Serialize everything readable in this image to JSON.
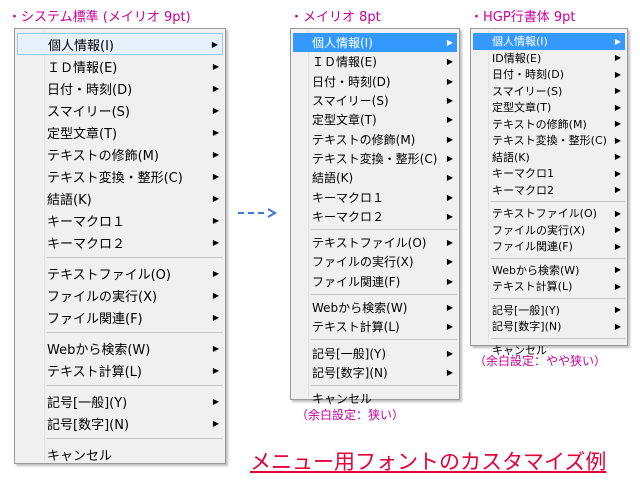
{
  "captions": {
    "menu1": "・システム標準 (メイリオ 9pt)",
    "menu2": "・メイリオ 8pt",
    "menu3": "・HGP行書体 9pt"
  },
  "notes": {
    "menu2": "（余白設定：狭い）",
    "menu3": "（余白設定：やや狭い）"
  },
  "footer": "メニュー用フォントのカスタマイズ例",
  "colors": {
    "caption": "#c8009a",
    "footer": "#e4003a",
    "highlight": "#3399ff",
    "arrow": "#4477dd"
  },
  "menu_groups": [
    [
      {
        "label": "個人情報(I)",
        "submenu": true
      },
      {
        "label": "ＩＤ情報(E)",
        "submenu": true
      },
      {
        "label": "日付・時刻(D)",
        "submenu": true
      },
      {
        "label": "スマイリー(S)",
        "submenu": true
      },
      {
        "label": "定型文章(T)",
        "submenu": true
      },
      {
        "label": "テキストの修飾(M)",
        "submenu": true
      },
      {
        "label": "テキスト変換・整形(C)",
        "submenu": true
      },
      {
        "label": "結語(K)",
        "submenu": true
      },
      {
        "label": "キーマクロ１",
        "submenu": true
      },
      {
        "label": "キーマクロ２",
        "submenu": true
      }
    ],
    [
      {
        "label": "テキストファイル(O)",
        "submenu": true
      },
      {
        "label": "ファイルの実行(X)",
        "submenu": true
      },
      {
        "label": "ファイル関連(F)",
        "submenu": true
      }
    ],
    [
      {
        "label": "Webから検索(W)",
        "submenu": true
      },
      {
        "label": "テキスト計算(L)",
        "submenu": true
      }
    ],
    [
      {
        "label": "記号[一般](Y)",
        "submenu": true
      },
      {
        "label": "記号[数字](N)",
        "submenu": true
      }
    ],
    [
      {
        "label": "キャンセル",
        "submenu": false
      }
    ]
  ],
  "menu3_groups": [
    [
      {
        "label": "個人情報(I)",
        "submenu": true
      },
      {
        "label": "ID情報(E)",
        "submenu": true
      },
      {
        "label": "日付・時刻(D)",
        "submenu": true
      },
      {
        "label": "スマイリー(S)",
        "submenu": true
      },
      {
        "label": "定型文章(T)",
        "submenu": true
      },
      {
        "label": "テキストの修飾(M)",
        "submenu": true
      },
      {
        "label": "テキスト変換・整形(C)",
        "submenu": true
      },
      {
        "label": "結語(K)",
        "submenu": true
      },
      {
        "label": "キーマクロ1",
        "submenu": true
      },
      {
        "label": "キーマクロ2",
        "submenu": true
      }
    ],
    [
      {
        "label": "テキストファイル(O)",
        "submenu": true
      },
      {
        "label": "ファイルの実行(X)",
        "submenu": true
      },
      {
        "label": "ファイル関連(F)",
        "submenu": true
      }
    ],
    [
      {
        "label": "Webから検索(W)",
        "submenu": true
      },
      {
        "label": "テキスト計算(L)",
        "submenu": true
      }
    ],
    [
      {
        "label": "記号[一般](Y)",
        "submenu": true
      },
      {
        "label": "記号[数字](N)",
        "submenu": true
      }
    ],
    [
      {
        "label": "キャンセル",
        "submenu": false
      }
    ]
  ],
  "highlighted_item": "個人情報(I)",
  "icons": {
    "submenu": "triangle-right-icon",
    "transition": "dashed-arrow-icon"
  }
}
